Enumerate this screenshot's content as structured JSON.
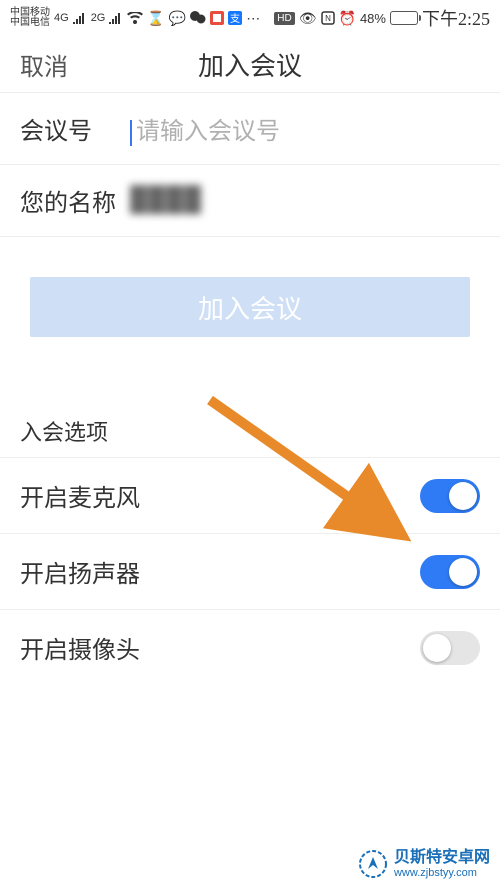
{
  "status": {
    "carrier1": "中国移动",
    "carrier2": "中国电信",
    "net1": "4G",
    "net2": "2G",
    "battery_pct": "48%",
    "time": "下午2:25"
  },
  "nav": {
    "cancel": "取消",
    "title": "加入会议"
  },
  "form": {
    "meeting_id_label": "会议号",
    "meeting_id_placeholder": "请输入会议号",
    "name_label": "您的名称",
    "name_value": "████"
  },
  "join_button": "加入会议",
  "options": {
    "header": "入会选项",
    "items": [
      {
        "label": "开启麦克风",
        "on": true
      },
      {
        "label": "开启扬声器",
        "on": true
      },
      {
        "label": "开启摄像头",
        "on": false
      }
    ]
  },
  "watermark": {
    "title": "贝斯特安卓网",
    "url": "www.zjbstyy.com"
  }
}
